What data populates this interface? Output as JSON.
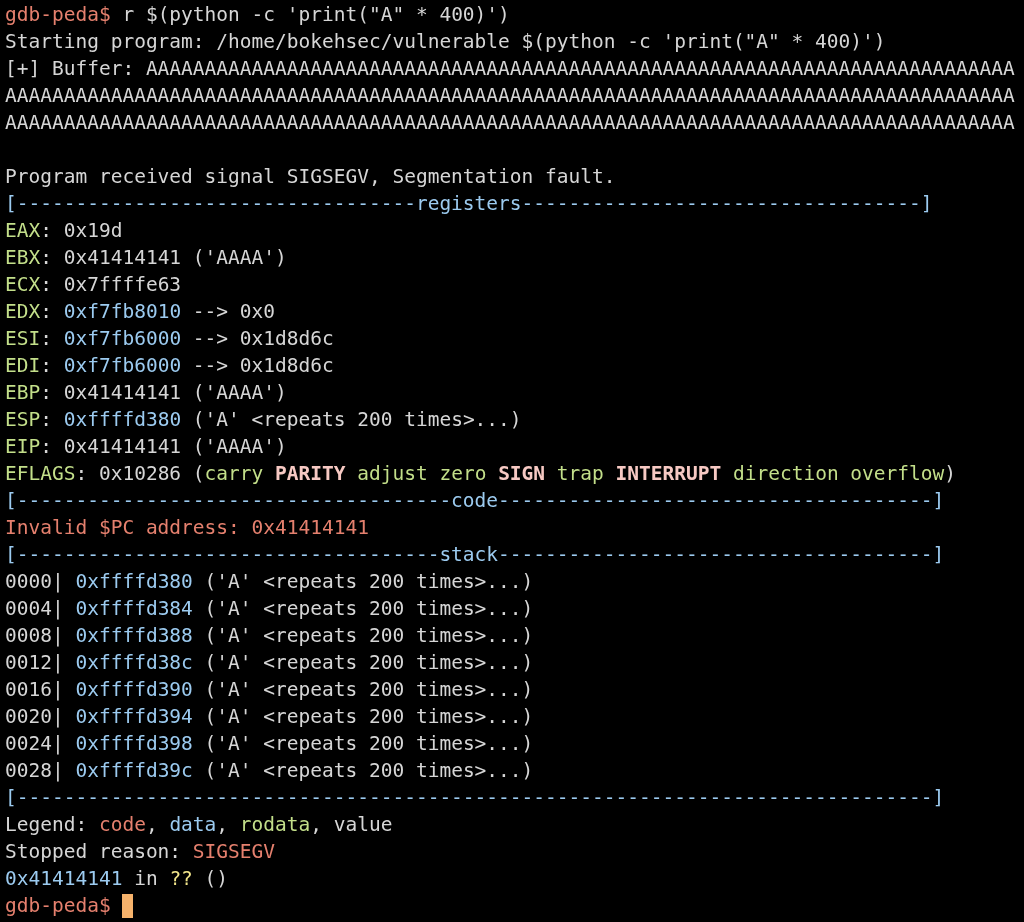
{
  "terminal": {
    "lines": [
      {
        "kind": "output",
        "segments": [
          {
            "kind": "prompt",
            "text": "gdb-peda$"
          },
          {
            "kind": "plain",
            "text": " r $(python -c 'print(\"A\" * 400)')"
          }
        ]
      },
      {
        "kind": "output",
        "segments": [
          {
            "kind": "plain",
            "text": "Starting program: /home/bokehsec/vulnerable $(python -c 'print(\"A\" * 400)')"
          }
        ]
      },
      {
        "kind": "output",
        "segments": [
          {
            "kind": "plain",
            "text": "[+] Buffer: AAAAAAAAAAAAAAAAAAAAAAAAAAAAAAAAAAAAAAAAAAAAAAAAAAAAAAAAAAAAAAAAAAAAAAAAAA"
          }
        ]
      },
      {
        "kind": "output",
        "segments": [
          {
            "kind": "plain",
            "text": "AAAAAAAAAAAAAAAAAAAAAAAAAAAAAAAAAAAAAAAAAAAAAAAAAAAAAAAAAAAAAAAAAAAAAAAAAAAAAAAAAAAAAA"
          }
        ]
      },
      {
        "kind": "output",
        "segments": [
          {
            "kind": "plain",
            "text": "AAAAAAAAAAAAAAAAAAAAAAAAAAAAAAAAAAAAAAAAAAAAAAAAAAAAAAAAAAAAAAAAAAAAAAAAAAAAAAAAAAAAAA"
          }
        ]
      },
      {
        "kind": "blank"
      },
      {
        "kind": "output",
        "segments": [
          {
            "kind": "plain",
            "text": "Program received signal SIGSEGV, Segmentation fault."
          }
        ]
      },
      {
        "kind": "output",
        "segments": [
          {
            "kind": "rule",
            "text": "[----------------------------------registers----------------------------------]"
          }
        ]
      },
      {
        "kind": "output",
        "segments": [
          {
            "kind": "register",
            "text": "EAX"
          },
          {
            "kind": "plain",
            "text": ": 0x19d"
          }
        ]
      },
      {
        "kind": "output",
        "segments": [
          {
            "kind": "register",
            "text": "EBX"
          },
          {
            "kind": "plain",
            "text": ": 0x41414141 ('AAAA')"
          }
        ]
      },
      {
        "kind": "output",
        "segments": [
          {
            "kind": "register",
            "text": "ECX"
          },
          {
            "kind": "plain",
            "text": ": 0x7ffffe63"
          }
        ]
      },
      {
        "kind": "output",
        "segments": [
          {
            "kind": "register",
            "text": "EDX"
          },
          {
            "kind": "plain",
            "text": ": "
          },
          {
            "kind": "pointer",
            "text": "0xf7fb8010"
          },
          {
            "kind": "plain",
            "text": " --> 0x0"
          }
        ]
      },
      {
        "kind": "output",
        "segments": [
          {
            "kind": "register",
            "text": "ESI"
          },
          {
            "kind": "plain",
            "text": ": "
          },
          {
            "kind": "pointer",
            "text": "0xf7fb6000"
          },
          {
            "kind": "plain",
            "text": " --> 0x1d8d6c"
          }
        ]
      },
      {
        "kind": "output",
        "segments": [
          {
            "kind": "register",
            "text": "EDI"
          },
          {
            "kind": "plain",
            "text": ": "
          },
          {
            "kind": "pointer",
            "text": "0xf7fb6000"
          },
          {
            "kind": "plain",
            "text": " --> 0x1d8d6c"
          }
        ]
      },
      {
        "kind": "output",
        "segments": [
          {
            "kind": "register",
            "text": "EBP"
          },
          {
            "kind": "plain",
            "text": ": 0x41414141 ('AAAA')"
          }
        ]
      },
      {
        "kind": "output",
        "segments": [
          {
            "kind": "register",
            "text": "ESP"
          },
          {
            "kind": "plain",
            "text": ": "
          },
          {
            "kind": "pointer",
            "text": "0xffffd380"
          },
          {
            "kind": "plain",
            "text": " ('A' <repeats 200 times>...)"
          }
        ]
      },
      {
        "kind": "output",
        "segments": [
          {
            "kind": "register",
            "text": "EIP"
          },
          {
            "kind": "plain",
            "text": ": 0x41414141 ('AAAA')"
          }
        ]
      },
      {
        "kind": "output",
        "segments": [
          {
            "kind": "register",
            "text": "EFLAGS"
          },
          {
            "kind": "plain",
            "text": ": 0x10286 ("
          },
          {
            "kind": "flag",
            "text": "carry "
          },
          {
            "kind": "flag_set",
            "text": "PARITY"
          },
          {
            "kind": "flag",
            "text": " adjust zero "
          },
          {
            "kind": "flag_set",
            "text": "SIGN"
          },
          {
            "kind": "flag",
            "text": " trap "
          },
          {
            "kind": "flag_set",
            "text": "INTERRUPT"
          },
          {
            "kind": "flag",
            "text": " direction overflow"
          },
          {
            "kind": "plain",
            "text": ")"
          }
        ]
      },
      {
        "kind": "output",
        "segments": [
          {
            "kind": "rule",
            "text": "[-------------------------------------code-------------------------------------]"
          }
        ]
      },
      {
        "kind": "output",
        "segments": [
          {
            "kind": "error",
            "text": "Invalid $PC address: 0x41414141"
          }
        ]
      },
      {
        "kind": "output",
        "segments": [
          {
            "kind": "rule",
            "text": "[------------------------------------stack-------------------------------------]"
          }
        ]
      },
      {
        "kind": "output",
        "segments": [
          {
            "kind": "plain",
            "text": "0000| "
          },
          {
            "kind": "pointer",
            "text": "0xffffd380"
          },
          {
            "kind": "plain",
            "text": " ('A' <repeats 200 times>...)"
          }
        ]
      },
      {
        "kind": "output",
        "segments": [
          {
            "kind": "plain",
            "text": "0004| "
          },
          {
            "kind": "pointer",
            "text": "0xffffd384"
          },
          {
            "kind": "plain",
            "text": " ('A' <repeats 200 times>...)"
          }
        ]
      },
      {
        "kind": "output",
        "segments": [
          {
            "kind": "plain",
            "text": "0008| "
          },
          {
            "kind": "pointer",
            "text": "0xffffd388"
          },
          {
            "kind": "plain",
            "text": " ('A' <repeats 200 times>...)"
          }
        ]
      },
      {
        "kind": "output",
        "segments": [
          {
            "kind": "plain",
            "text": "0012| "
          },
          {
            "kind": "pointer",
            "text": "0xffffd38c"
          },
          {
            "kind": "plain",
            "text": " ('A' <repeats 200 times>...)"
          }
        ]
      },
      {
        "kind": "output",
        "segments": [
          {
            "kind": "plain",
            "text": "0016| "
          },
          {
            "kind": "pointer",
            "text": "0xffffd390"
          },
          {
            "kind": "plain",
            "text": " ('A' <repeats 200 times>...)"
          }
        ]
      },
      {
        "kind": "output",
        "segments": [
          {
            "kind": "plain",
            "text": "0020| "
          },
          {
            "kind": "pointer",
            "text": "0xffffd394"
          },
          {
            "kind": "plain",
            "text": " ('A' <repeats 200 times>...)"
          }
        ]
      },
      {
        "kind": "output",
        "segments": [
          {
            "kind": "plain",
            "text": "0024| "
          },
          {
            "kind": "pointer",
            "text": "0xffffd398"
          },
          {
            "kind": "plain",
            "text": " ('A' <repeats 200 times>...)"
          }
        ]
      },
      {
        "kind": "output",
        "segments": [
          {
            "kind": "plain",
            "text": "0028| "
          },
          {
            "kind": "pointer",
            "text": "0xffffd39c"
          },
          {
            "kind": "plain",
            "text": " ('A' <repeats 200 times>...)"
          }
        ]
      },
      {
        "kind": "output",
        "segments": [
          {
            "kind": "rule",
            "text": "[------------------------------------------------------------------------------]"
          }
        ]
      },
      {
        "kind": "output",
        "segments": [
          {
            "kind": "plain",
            "text": "Legend: "
          },
          {
            "kind": "error",
            "text": "code"
          },
          {
            "kind": "plain",
            "text": ", "
          },
          {
            "kind": "pointer",
            "text": "data"
          },
          {
            "kind": "plain",
            "text": ", "
          },
          {
            "kind": "register",
            "text": "rodata"
          },
          {
            "kind": "plain",
            "text": ", value"
          }
        ]
      },
      {
        "kind": "output",
        "segments": [
          {
            "kind": "plain",
            "text": "Stopped reason: "
          },
          {
            "kind": "error",
            "text": "SIGSEGV"
          }
        ]
      },
      {
        "kind": "output",
        "segments": [
          {
            "kind": "pointer",
            "text": "0x41414141"
          },
          {
            "kind": "plain",
            "text": " in "
          },
          {
            "kind": "unknown",
            "text": "??"
          },
          {
            "kind": "plain",
            "text": " ()"
          }
        ]
      },
      {
        "kind": "prompt",
        "segments": [
          {
            "kind": "prompt",
            "text": "gdb-peda$"
          }
        ]
      }
    ]
  }
}
